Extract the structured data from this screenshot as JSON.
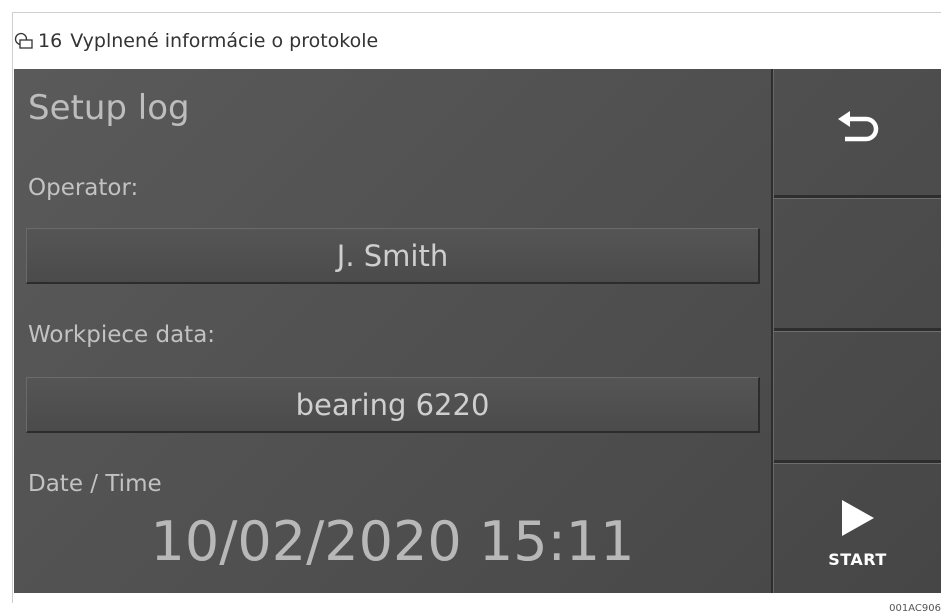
{
  "figure_caption": {
    "number": "16",
    "text": "Vyplnené informácie o protokole",
    "icon": "figure-icon"
  },
  "screen": {
    "title": "Setup log",
    "operator": {
      "label": "Operator:",
      "value": "J. Smith"
    },
    "workpiece": {
      "label": "Workpiece data:",
      "value": "bearing 6220"
    },
    "datetime": {
      "label": "Date / Time",
      "value": "10/02/2020 15:11"
    }
  },
  "sidebar": {
    "back_icon": "back-arrow-icon",
    "start_icon": "play-icon",
    "start_label": "START"
  },
  "image_code": "001AC906"
}
